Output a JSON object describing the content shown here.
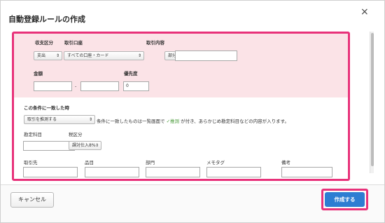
{
  "dialog": {
    "title": "自動登録ルールの作成",
    "close_icon": "×"
  },
  "conditions": {
    "type_label": "収支区分",
    "type_value": "支出",
    "account_label": "取引口座",
    "account_value": "すべての口座・カード",
    "content_label": "取引内容",
    "match_value": "部分一致",
    "content_input": "",
    "amount_label": "金額",
    "amount_min": "",
    "amount_sep": "-",
    "amount_max": "",
    "priority_label": "優先度",
    "priority_value": "0"
  },
  "action": {
    "section_title": "この条件に一致した時",
    "action_value": "取引を推測する",
    "desc_prefix": "条件に一致したものは一覧画面で",
    "desc_tag": "✓推測",
    "desc_suffix": "が付き、あらかじめ勘定科目などの内容が入ります。",
    "account_item_label": "勘定科目",
    "account_item_value": "",
    "tax_label": "税区分",
    "tax_value": "課対仕入8%",
    "partner_label": "取引先",
    "item_label": "品目",
    "dept_label": "部門",
    "memo_label": "メモタグ",
    "note_label": "備考"
  },
  "footer": {
    "cancel_label": "キャンセル",
    "create_label": "作成する"
  },
  "colors": {
    "highlight": "#e8327a",
    "pink_bg": "#fbe3e7",
    "primary": "#2d7dd2"
  }
}
